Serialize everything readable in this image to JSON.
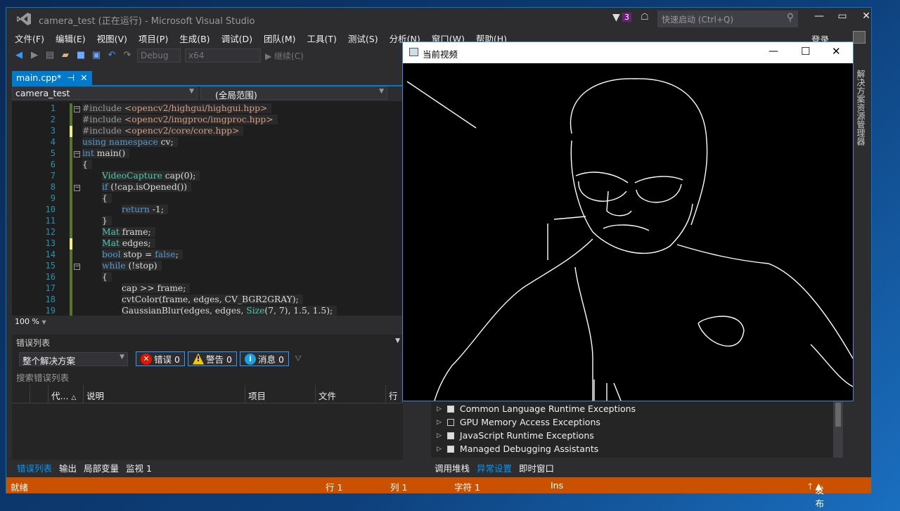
{
  "window": {
    "title": "camera_test (正在运行) - Microsoft Visual Studio",
    "notifications": "3",
    "quick_launch_placeholder": "快速启动 (Ctrl+Q)",
    "login": "登录"
  },
  "menu": [
    "文件(F)",
    "编辑(E)",
    "视图(V)",
    "项目(P)",
    "生成(B)",
    "调试(D)",
    "团队(M)",
    "工具(T)",
    "测试(S)",
    "分析(N)",
    "窗口(W)",
    "帮助(H)"
  ],
  "toolbar": {
    "config": "Debug",
    "platform": "x64",
    "continue": "继续(C)"
  },
  "doc_tab": {
    "label": "main.cpp*",
    "pin": "⊣",
    "close": "✕"
  },
  "nav": {
    "project": "camera_test",
    "scope": "(全局范围)"
  },
  "code": {
    "line_numbers": [
      "1",
      "2",
      "3",
      "4",
      "5",
      "6",
      "7",
      "8",
      "9",
      "10",
      "11",
      "12",
      "13",
      "14",
      "15",
      "16",
      "17",
      "18",
      "19"
    ],
    "lines": [
      {
        "indent": 0,
        "tokens": [
          [
            "#include ",
            "pp"
          ],
          [
            "<opencv2/highgui/highgui.hpp>",
            "st"
          ]
        ]
      },
      {
        "indent": 0,
        "tokens": [
          [
            "#include ",
            "pp"
          ],
          [
            "<opencv2/imgproc/imgproc.hpp>",
            "st"
          ]
        ]
      },
      {
        "indent": 0,
        "tokens": [
          [
            "#include ",
            "pp"
          ],
          [
            "<opencv2/core/core.hpp>",
            "st"
          ]
        ]
      },
      {
        "indent": 0,
        "tokens": [
          [
            "using ",
            "kw"
          ],
          [
            "namespace ",
            "kw"
          ],
          [
            "cv;",
            ""
          ]
        ]
      },
      {
        "indent": 0,
        "tokens": [
          [
            "int ",
            "kw"
          ],
          [
            "main()",
            ""
          ]
        ]
      },
      {
        "indent": 0,
        "tokens": [
          [
            "{",
            ""
          ]
        ]
      },
      {
        "indent": 1,
        "tokens": [
          [
            "VideoCapture ",
            "ty"
          ],
          [
            "cap(0);",
            ""
          ]
        ]
      },
      {
        "indent": 1,
        "tokens": [
          [
            "if ",
            "kw"
          ],
          [
            "(!cap.isOpened())",
            ""
          ]
        ]
      },
      {
        "indent": 1,
        "tokens": [
          [
            "{",
            ""
          ]
        ]
      },
      {
        "indent": 2,
        "tokens": [
          [
            "return ",
            "kw"
          ],
          [
            "-1;",
            ""
          ]
        ]
      },
      {
        "indent": 1,
        "tokens": [
          [
            "}",
            ""
          ]
        ]
      },
      {
        "indent": 1,
        "tokens": [
          [
            "Mat ",
            "ty"
          ],
          [
            "frame;",
            ""
          ]
        ]
      },
      {
        "indent": 1,
        "tokens": [
          [
            "Mat ",
            "ty"
          ],
          [
            "edges;",
            ""
          ]
        ]
      },
      {
        "indent": 1,
        "tokens": [
          [
            "bool ",
            "kw"
          ],
          [
            "stop = ",
            ""
          ],
          [
            "false",
            "kw"
          ],
          [
            ";",
            ""
          ]
        ]
      },
      {
        "indent": 1,
        "tokens": [
          [
            "while ",
            "kw"
          ],
          [
            "(!stop)",
            ""
          ]
        ]
      },
      {
        "indent": 1,
        "tokens": [
          [
            "{",
            ""
          ]
        ]
      },
      {
        "indent": 2,
        "tokens": [
          [
            "cap >> frame;",
            ""
          ]
        ]
      },
      {
        "indent": 2,
        "tokens": [
          [
            "cvtColor(frame, edges, CV_BGR2GRAY);",
            ""
          ]
        ]
      },
      {
        "indent": 2,
        "tokens": [
          [
            "GaussianBlur(edges, edges, ",
            ""
          ],
          [
            "Size",
            "ty"
          ],
          [
            "(7, 7), 1.5, 1.5);",
            ""
          ]
        ]
      }
    ]
  },
  "zoom": "100 %",
  "error_list": {
    "title": "错误列表",
    "scope": "整个解决方案",
    "errors": "错误 0",
    "warnings": "警告 0",
    "messages": "消息 0",
    "search_placeholder": "搜索错误列表",
    "columns": [
      "代...",
      "说明",
      "项目",
      "文件",
      "行"
    ]
  },
  "bottom_tabs_left": [
    "错误列表",
    "输出",
    "局部变量",
    "监视 1"
  ],
  "bottom_tabs_right": [
    "调用堆栈",
    "异常设置",
    "即时窗口"
  ],
  "exceptions": [
    {
      "label": "Common Language Runtime Exceptions",
      "checked": true
    },
    {
      "label": "GPU Memory Access Exceptions",
      "checked": false
    },
    {
      "label": "JavaScript Runtime Exceptions",
      "checked": true
    },
    {
      "label": "Managed Debugging Assistants",
      "checked": true
    }
  ],
  "side_tab": "解决方案资源管理器",
  "status": {
    "ready": "就绪",
    "line": "行 1",
    "col": "列 1",
    "char": "字符 1",
    "mode": "Ins",
    "publish": "发布"
  },
  "video_window": {
    "title": "当前视频"
  },
  "colors": {
    "accent": "#007acc",
    "status_bar": "#ca5100",
    "editor_bg": "#1e1e1e"
  }
}
